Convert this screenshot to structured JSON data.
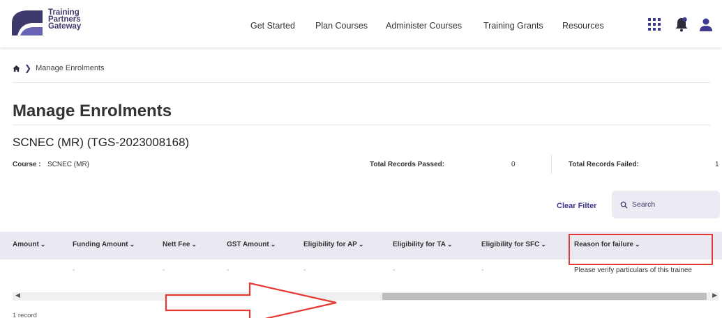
{
  "brand": {
    "line1": "Training",
    "line2": "Partners",
    "line3": "Gateway",
    "color": "#3d3a6b"
  },
  "nav": {
    "items": [
      "Get Started",
      "Plan Courses",
      "Administer Courses",
      "Training Grants",
      "Resources"
    ]
  },
  "header_icons": [
    "apps-grid-icon",
    "notification-bell-icon",
    "user-account-icon"
  ],
  "breadcrumb": {
    "home_icon": "home-icon",
    "separator_icon": "chevron-right-icon",
    "current": "Manage Enrolments"
  },
  "page": {
    "title": "Manage Enrolments",
    "subtitle": "SCNEC (MR) (TGS-2023008168)"
  },
  "meta": {
    "course_label": "Course :",
    "course_value": "SCNEC (MR)",
    "passed_label": "Total Records Passed:",
    "passed_value": "0",
    "failed_label": "Total Records Failed:",
    "failed_value": "1"
  },
  "filter": {
    "clear_label": "Clear Filter",
    "search_placeholder": "Search"
  },
  "table": {
    "columns": [
      "Amount",
      "Funding Amount",
      "Nett Fee",
      "GST Amount",
      "Eligibility for AP",
      "Eligibility for TA",
      "Eligibility for SFC",
      "Reason for failure"
    ],
    "rows": [
      [
        "",
        "-",
        "-",
        "-",
        "-",
        "-",
        "-",
        "Please verify particulars of this trainee"
      ]
    ]
  },
  "footer": {
    "records": "1 record"
  },
  "colors": {
    "accent": "#3d3a8f",
    "header_bg": "#eae9f1",
    "annotation": "#e53935"
  }
}
